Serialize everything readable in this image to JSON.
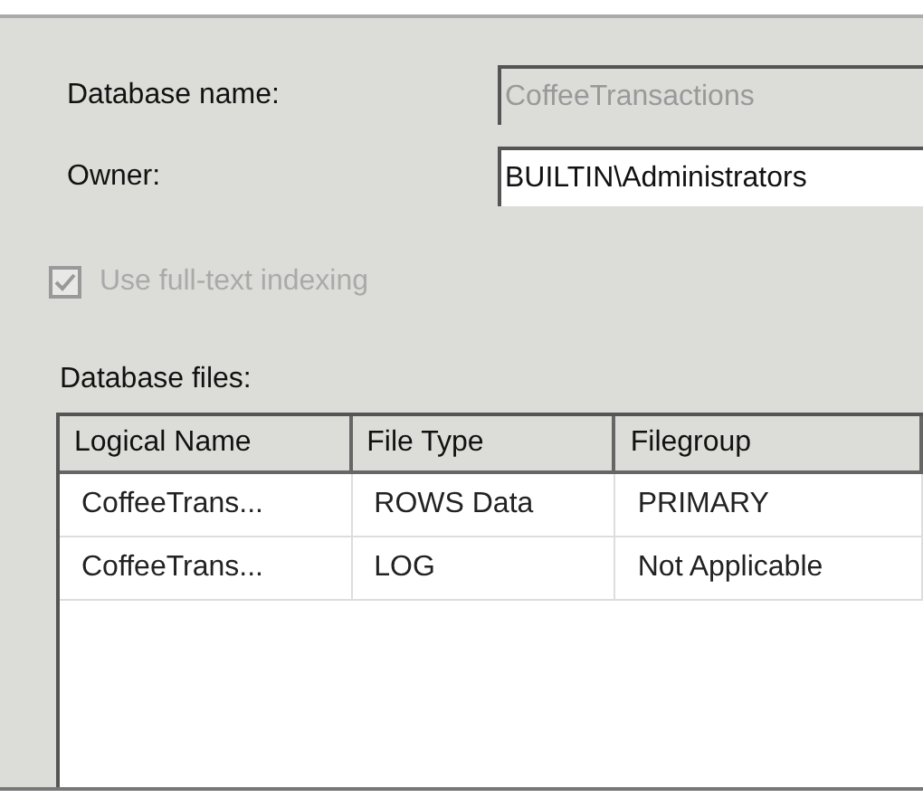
{
  "database_name": {
    "label": "Database name:",
    "value": "CoffeeTransactions",
    "disabled": true
  },
  "owner": {
    "label": "Owner:",
    "value": "BUILTIN\\Administrators",
    "disabled": false
  },
  "full_text_indexing": {
    "label": "Use full-text indexing",
    "checked": true,
    "disabled": true
  },
  "files_label": "Database files:",
  "table": {
    "columns": [
      "Logical Name",
      "File Type",
      "Filegroup"
    ],
    "rows": [
      [
        "CoffeeTrans...",
        "ROWS Data",
        "PRIMARY"
      ],
      [
        "CoffeeTrans...",
        "LOG",
        "Not Applicable"
      ]
    ]
  }
}
